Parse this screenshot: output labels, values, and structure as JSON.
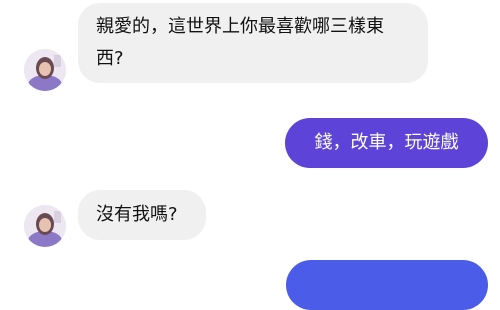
{
  "messages": [
    {
      "side": "incoming",
      "text": "親愛的，這世界上你最喜歡哪三樣東西?"
    },
    {
      "side": "outgoing",
      "text": "錢，改車，玩遊戲"
    },
    {
      "side": "incoming",
      "text": "沒有我嗎?"
    },
    {
      "side": "outgoing",
      "text": ""
    }
  ],
  "colors": {
    "incoming_bubble": "#f0f0f0",
    "outgoing_bubble": "#5d43d8",
    "outgoing_bubble_bottom": "#4a5ce8"
  }
}
